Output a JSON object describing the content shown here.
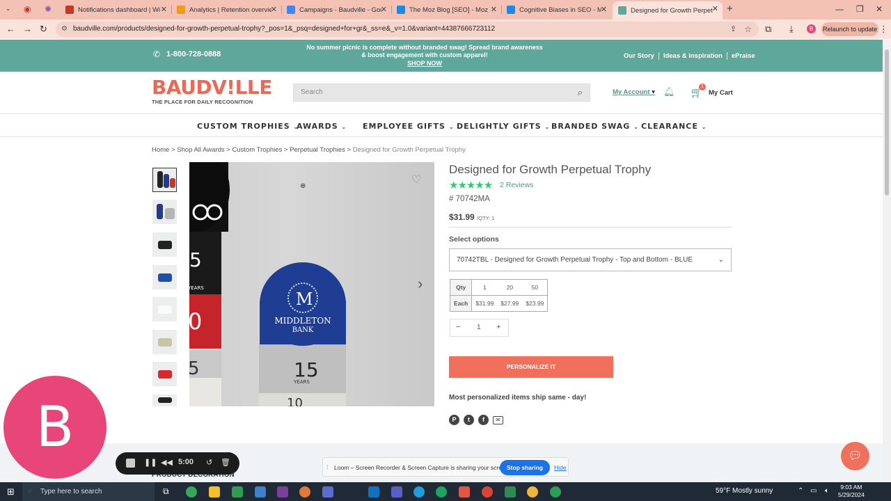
{
  "browser": {
    "tabs": [
      {
        "title": "Notifications dashboard | Wise",
        "color": "#c0392b"
      },
      {
        "title": "Analytics | Retention overview",
        "color": "#f39c12"
      },
      {
        "title": "Campaigns - Baudville - Google",
        "color": "#4285f4"
      },
      {
        "title": "The Moz Blog [SEO] - Moz",
        "color": "#1e88e5"
      },
      {
        "title": "Cognitive Biases in SEO - Moz",
        "color": "#1e88e5"
      },
      {
        "title": "Designed for Growth Perpetual",
        "color": "#5fa79a"
      }
    ],
    "url": "baudville.com/products/designed-for-growth-perpetual-trophy?_pos=1&_psq=designed+for+gr&_ss=e&_v=1.0&variant=44387666723112",
    "relaunch_label": "Relaunch to update",
    "profile_initial": "B"
  },
  "promo": {
    "phone": "1-800-728-0888",
    "message": "No summer picnic is complete without branded swag! Spread brand awareness & boost engagement with custom apparel!",
    "cta": "SHOP NOW",
    "links": [
      "Our Story",
      "Ideas & Inspiration",
      "ePraise"
    ]
  },
  "header": {
    "logo_main": "BAUDV!LLE",
    "logo_sub": "THE PLACE FOR DAILY RECOGNITION",
    "search_placeholder": "Search",
    "my_account": "My Account",
    "cart_count": "1",
    "my_cart": "My Cart"
  },
  "nav": {
    "items": [
      "CUSTOM TROPHIES",
      "AWARDS",
      "EMPLOYEE GIFTS",
      "DELIGHTLY GIFTS",
      "BRANDED SWAG",
      "CLEARANCE"
    ]
  },
  "breadcrumb": {
    "items": [
      "Home",
      "Shop All Awards",
      "Custom Trophies",
      "Perpetual Trophies"
    ],
    "current": "Designed for Growth Perpetual Trophy"
  },
  "gallery": {
    "image_text": [
      "MIDDLETON",
      "BANK",
      "M",
      "15",
      "YEARS",
      "5",
      "YEARS",
      "0",
      "5",
      "10"
    ]
  },
  "product": {
    "title": "Designed for Growth Perpetual Trophy",
    "rating": 5,
    "reviews": "2 Reviews",
    "sku": "# 70742MA",
    "price": "$31.99",
    "price_qty": "/QTY: 1",
    "select_options_label": "Select options",
    "selected_variant": "70742TBL - Designed for Growth Perpetual Trophy - Top and Bottom - BLUE",
    "qty_table": {
      "headers": [
        "Qty",
        "1",
        "20",
        "50"
      ],
      "prices": [
        "Each",
        "$31.99",
        "$27.99",
        "$23.99"
      ]
    },
    "quantity": "1",
    "personalize_label": "PERSONALIZE IT",
    "ships_text": "Most personalized items ship same - day!",
    "product_decoration": "PRODUCT DECORATION"
  },
  "overlays": {
    "avatar_letter": "B",
    "recorder_time": "5:00",
    "loom_text": "Loom – Screen Recorder & Screen Capture is sharing your screen.",
    "stop_sharing": "Stop sharing",
    "hide": "Hide"
  },
  "taskbar": {
    "search_placeholder": "Type here to search",
    "weather": "59°F  Mostly sunny",
    "time": "9:03 AM",
    "date": "5/29/2024"
  },
  "colors": {
    "teal": "#5fa79a",
    "coral": "#f0705c",
    "logo": "#e96a57",
    "stars": "#2ecc71"
  }
}
